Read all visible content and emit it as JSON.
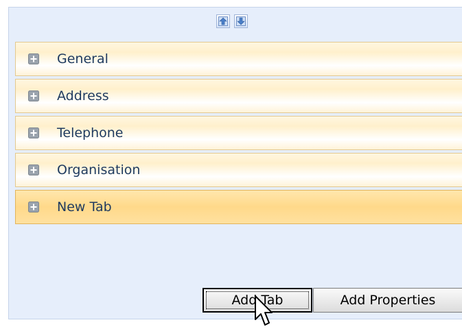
{
  "toolbar": {
    "move_up_icon": "arrow-up-icon",
    "move_down_icon": "arrow-down-icon"
  },
  "tabs": [
    {
      "label": "General",
      "selected": false
    },
    {
      "label": "Address",
      "selected": false
    },
    {
      "label": "Telephone",
      "selected": false
    },
    {
      "label": "Organisation",
      "selected": false
    },
    {
      "label": "New Tab",
      "selected": true
    }
  ],
  "buttons": {
    "add_tab": "Add Tab",
    "add_properties": "Add Properties"
  },
  "colors": {
    "panel_bg": "#e6eefb",
    "tab_bg": "#fff3d8",
    "tab_selected_bg": "#ffd98a",
    "tab_text": "#1e3a5f"
  }
}
